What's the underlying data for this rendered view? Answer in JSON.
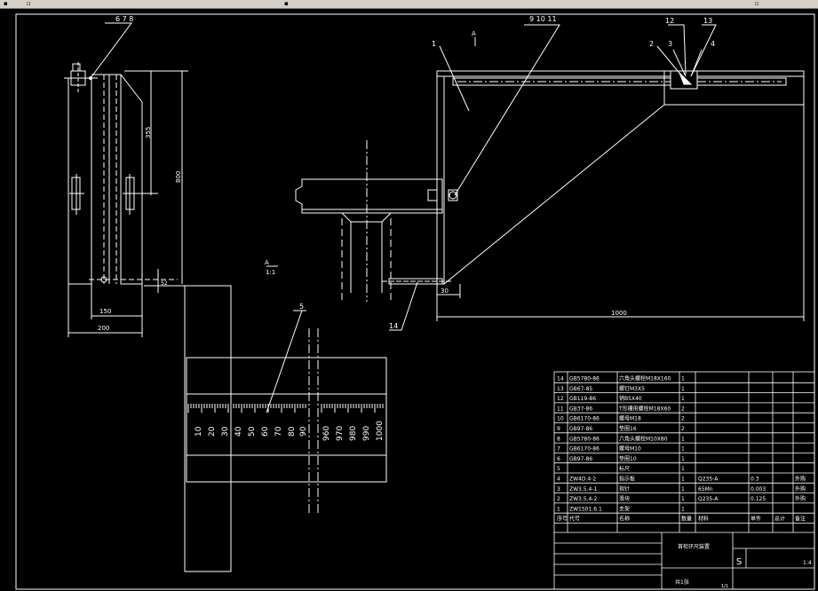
{
  "toolbar": {
    "icons": [
      "folder-icon",
      "image-icon",
      "grid-icon",
      "layer-icon"
    ]
  },
  "callouts": {
    "c678": "6 7 8",
    "c91011": "9 10 11",
    "c1": "1",
    "c12": "12",
    "c13": "13",
    "c2": "2",
    "c3": "3",
    "c4": "4",
    "c5": "5",
    "c14": "14"
  },
  "section_marks": {
    "a_top": "A",
    "a_mid": "A",
    "a_view": "1:1"
  },
  "dimensions": {
    "d355": "355",
    "d800": "800",
    "d150": "150",
    "d200": "200",
    "d52": "52",
    "d30": "30",
    "d1000": "1000"
  },
  "ruler_labels": [
    "10",
    "20",
    "30",
    "40",
    "50",
    "60",
    "70",
    "80",
    "90",
    "960",
    "970",
    "980",
    "990",
    "1000"
  ],
  "parts_list": [
    {
      "no": "14",
      "code": "GB5780-86",
      "name": "六角头螺栓M18X160",
      "qty": "1",
      "material": "",
      "weight": "",
      "total": "",
      "remark": ""
    },
    {
      "no": "13",
      "code": "GB67-85",
      "name": "螺钉M3X5",
      "qty": "1",
      "material": "",
      "weight": "",
      "total": "",
      "remark": ""
    },
    {
      "no": "12",
      "code": "GB119-86",
      "name": "销B5X40",
      "qty": "1",
      "material": "",
      "weight": "",
      "total": "",
      "remark": ""
    },
    {
      "no": "11",
      "code": "GB37-86",
      "name": "T形槽用螺栓M18X60",
      "qty": "2",
      "material": "",
      "weight": "",
      "total": "",
      "remark": ""
    },
    {
      "no": "10",
      "code": "GB6170-86",
      "name": "螺母M18",
      "qty": "2",
      "material": "",
      "weight": "",
      "total": "",
      "remark": ""
    },
    {
      "no": "9",
      "code": "GB97-86",
      "name": "垫圈16",
      "qty": "2",
      "material": "",
      "weight": "",
      "total": "",
      "remark": ""
    },
    {
      "no": "8",
      "code": "GB5780-86",
      "name": "六角头螺栓M10X80",
      "qty": "1",
      "material": "",
      "weight": "",
      "total": "",
      "remark": ""
    },
    {
      "no": "7",
      "code": "GB6170-86",
      "name": "螺母M10",
      "qty": "1",
      "material": "",
      "weight": "",
      "total": "",
      "remark": ""
    },
    {
      "no": "6",
      "code": "GB97-86",
      "name": "垫圈10",
      "qty": "1",
      "material": "",
      "weight": "",
      "total": "",
      "remark": ""
    },
    {
      "no": "5",
      "code": "",
      "name": "标尺",
      "qty": "1",
      "material": "",
      "weight": "",
      "total": "",
      "remark": ""
    },
    {
      "no": "4",
      "code": "ZW4D.4-2",
      "name": "指示板",
      "qty": "1",
      "material": "Q235-A",
      "weight": "0.3",
      "total": "",
      "remark": "外购"
    },
    {
      "no": "3",
      "code": "ZW3.5.4-1",
      "name": "指针",
      "qty": "1",
      "material": "65Mn",
      "weight": "0.003",
      "total": "",
      "remark": "外购"
    },
    {
      "no": "2",
      "code": "ZW3.5.4-2",
      "name": "滑块",
      "qty": "1",
      "material": "Q235-A",
      "weight": "0.125",
      "total": "",
      "remark": "外购"
    },
    {
      "no": "1",
      "code": "ZW1501.6.1",
      "name": "支架",
      "qty": "1",
      "material": "",
      "weight": "",
      "total": "",
      "remark": ""
    }
  ],
  "parts_header": {
    "no": "序号",
    "code": "代号",
    "name": "名称",
    "qty": "数量",
    "material": "材料",
    "weight": "单件",
    "total": "总计",
    "remark": "备注"
  },
  "title_block": {
    "title": "首检环尺装置",
    "scale_label": "S",
    "scale": "1:4",
    "sheet": "共1张",
    "sheet_of": "1/1"
  }
}
